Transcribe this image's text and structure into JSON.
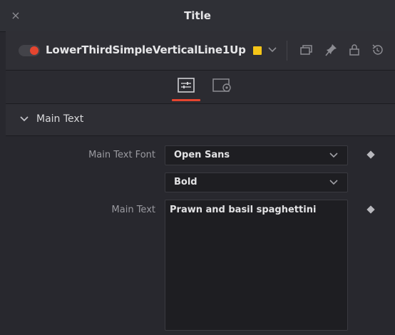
{
  "window": {
    "title": "Title",
    "close_glyph": "×"
  },
  "header": {
    "node_name": "LowerThirdSimpleVerticalLine1Up",
    "node_enabled": true,
    "color_swatch": "#f5c518",
    "icons": [
      "duplicate-window-icon",
      "pin-icon",
      "lock-icon",
      "reset-icon"
    ]
  },
  "tabs": [
    {
      "name": "inspector-tab",
      "icon": "sliders-icon",
      "active": true
    },
    {
      "name": "settings-tab",
      "icon": "settings-gear-icon",
      "active": false
    }
  ],
  "section": {
    "label": "Main Text",
    "expanded": true
  },
  "properties": {
    "font_label": "Main Text Font",
    "font_family": "Open Sans",
    "font_style": "Bold",
    "text_label": "Main Text",
    "text_value": "Prawn and basil spaghettini"
  },
  "colors": {
    "accent": "#e5452f",
    "swatch": "#f5c518"
  }
}
